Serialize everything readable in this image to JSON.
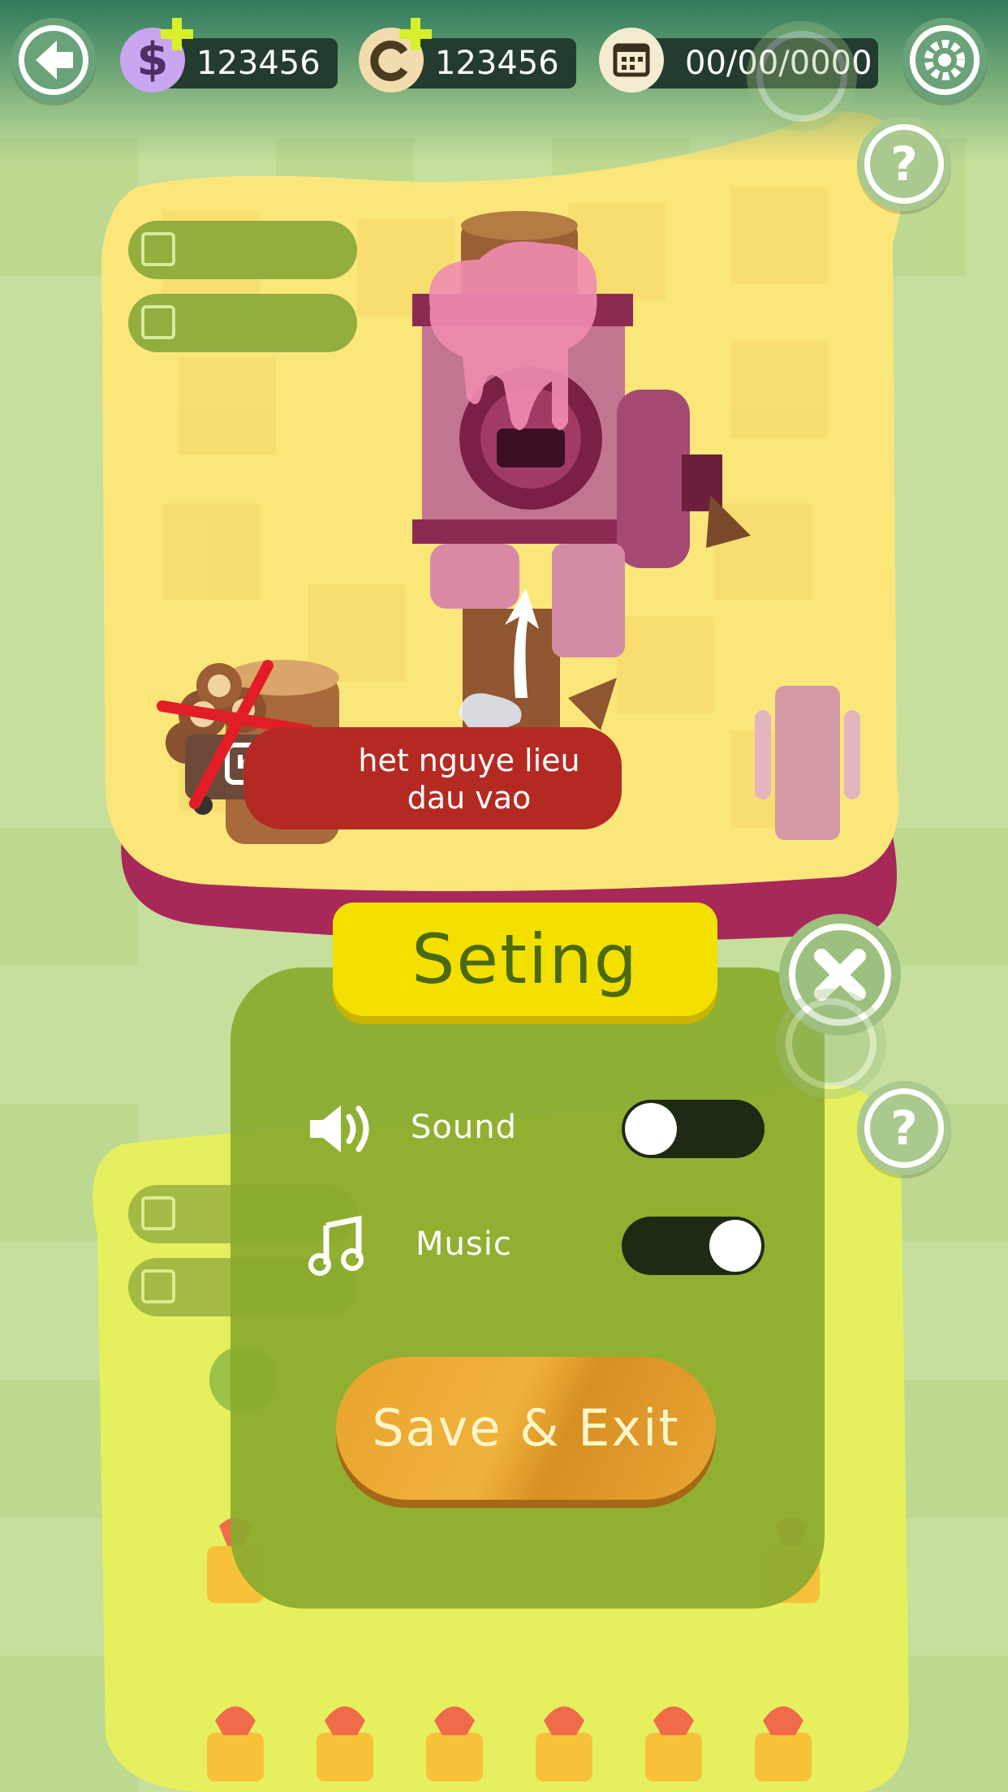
{
  "hud": {
    "money_value": "123456",
    "gem_value": "123456",
    "date_value": "00/00/0000"
  },
  "tooltip": {
    "line1": "het nguye lieu",
    "line2": "dau vao"
  },
  "settings": {
    "title": "Seting",
    "sound_label": "Sound",
    "sound_on": false,
    "music_label": "Music",
    "music_on": true,
    "save_exit_label": "Save & Exit"
  },
  "icons": {
    "back": "back-arrow-icon",
    "money": "dollar-icon",
    "gem": "gem-icon",
    "calendar": "calendar-icon",
    "settings": "gear-icon",
    "help": "question-icon",
    "close": "close-icon",
    "sound": "speaker-icon",
    "music": "music-note-icon"
  },
  "colors": {
    "popup": "#8aab2e",
    "banner": "#f3e000",
    "tooltip": "#b42a23",
    "save_button": "#eaa533"
  }
}
